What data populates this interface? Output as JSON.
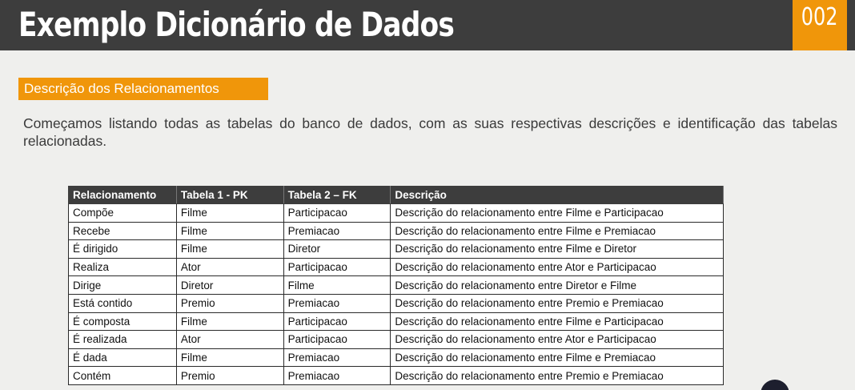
{
  "header": {
    "title": "Exemplo Dicionário de Dados",
    "slide_number": "002"
  },
  "section": {
    "label": "Descrição dos Relacionamentos"
  },
  "intro_text": "Começamos listando todas as tabelas do banco de dados, com as suas respectivas descrições e identificação das tabelas relacionadas.",
  "table": {
    "columns": [
      "Relacionamento",
      "Tabela 1 - PK",
      "Tabela 2 – FK",
      "Descrição"
    ],
    "rows": [
      [
        "Compõe",
        "Filme",
        "Participacao",
        "Descrição do relacionamento entre Filme e Participacao"
      ],
      [
        "Recebe",
        "Filme",
        "Premiacao",
        "Descrição do relacionamento entre Filme e Premiacao"
      ],
      [
        "É dirigido",
        "Filme",
        "Diretor",
        "Descrição do relacionamento entre Filme e Diretor"
      ],
      [
        "Realiza",
        "Ator",
        "Participacao",
        "Descrição do relacionamento entre Ator e Participacao"
      ],
      [
        "Dirige",
        "Diretor",
        "Filme",
        "Descrição do relacionamento entre Diretor e Filme"
      ],
      [
        "Está contido",
        "Premio",
        "Premiacao",
        "Descrição do relacionamento entre Premio e Premiacao"
      ],
      [
        "É composta",
        "Filme",
        "Participacao",
        "Descrição do relacionamento entre Filme e Participacao"
      ],
      [
        "É realizada",
        "Ator",
        "Participacao",
        "Descrição do relacionamento entre Ator e Participacao"
      ],
      [
        "É dada",
        "Filme",
        "Premiacao",
        "Descrição do relacionamento entre Filme e Premiacao"
      ],
      [
        "Contém",
        "Premio",
        "Premiacao",
        "Descrição do relacionamento entre Premio e Premiacao"
      ]
    ]
  },
  "colors": {
    "header_bg": "#3d3d3d",
    "accent": "#f0960a",
    "page_bg": "#efefed"
  }
}
